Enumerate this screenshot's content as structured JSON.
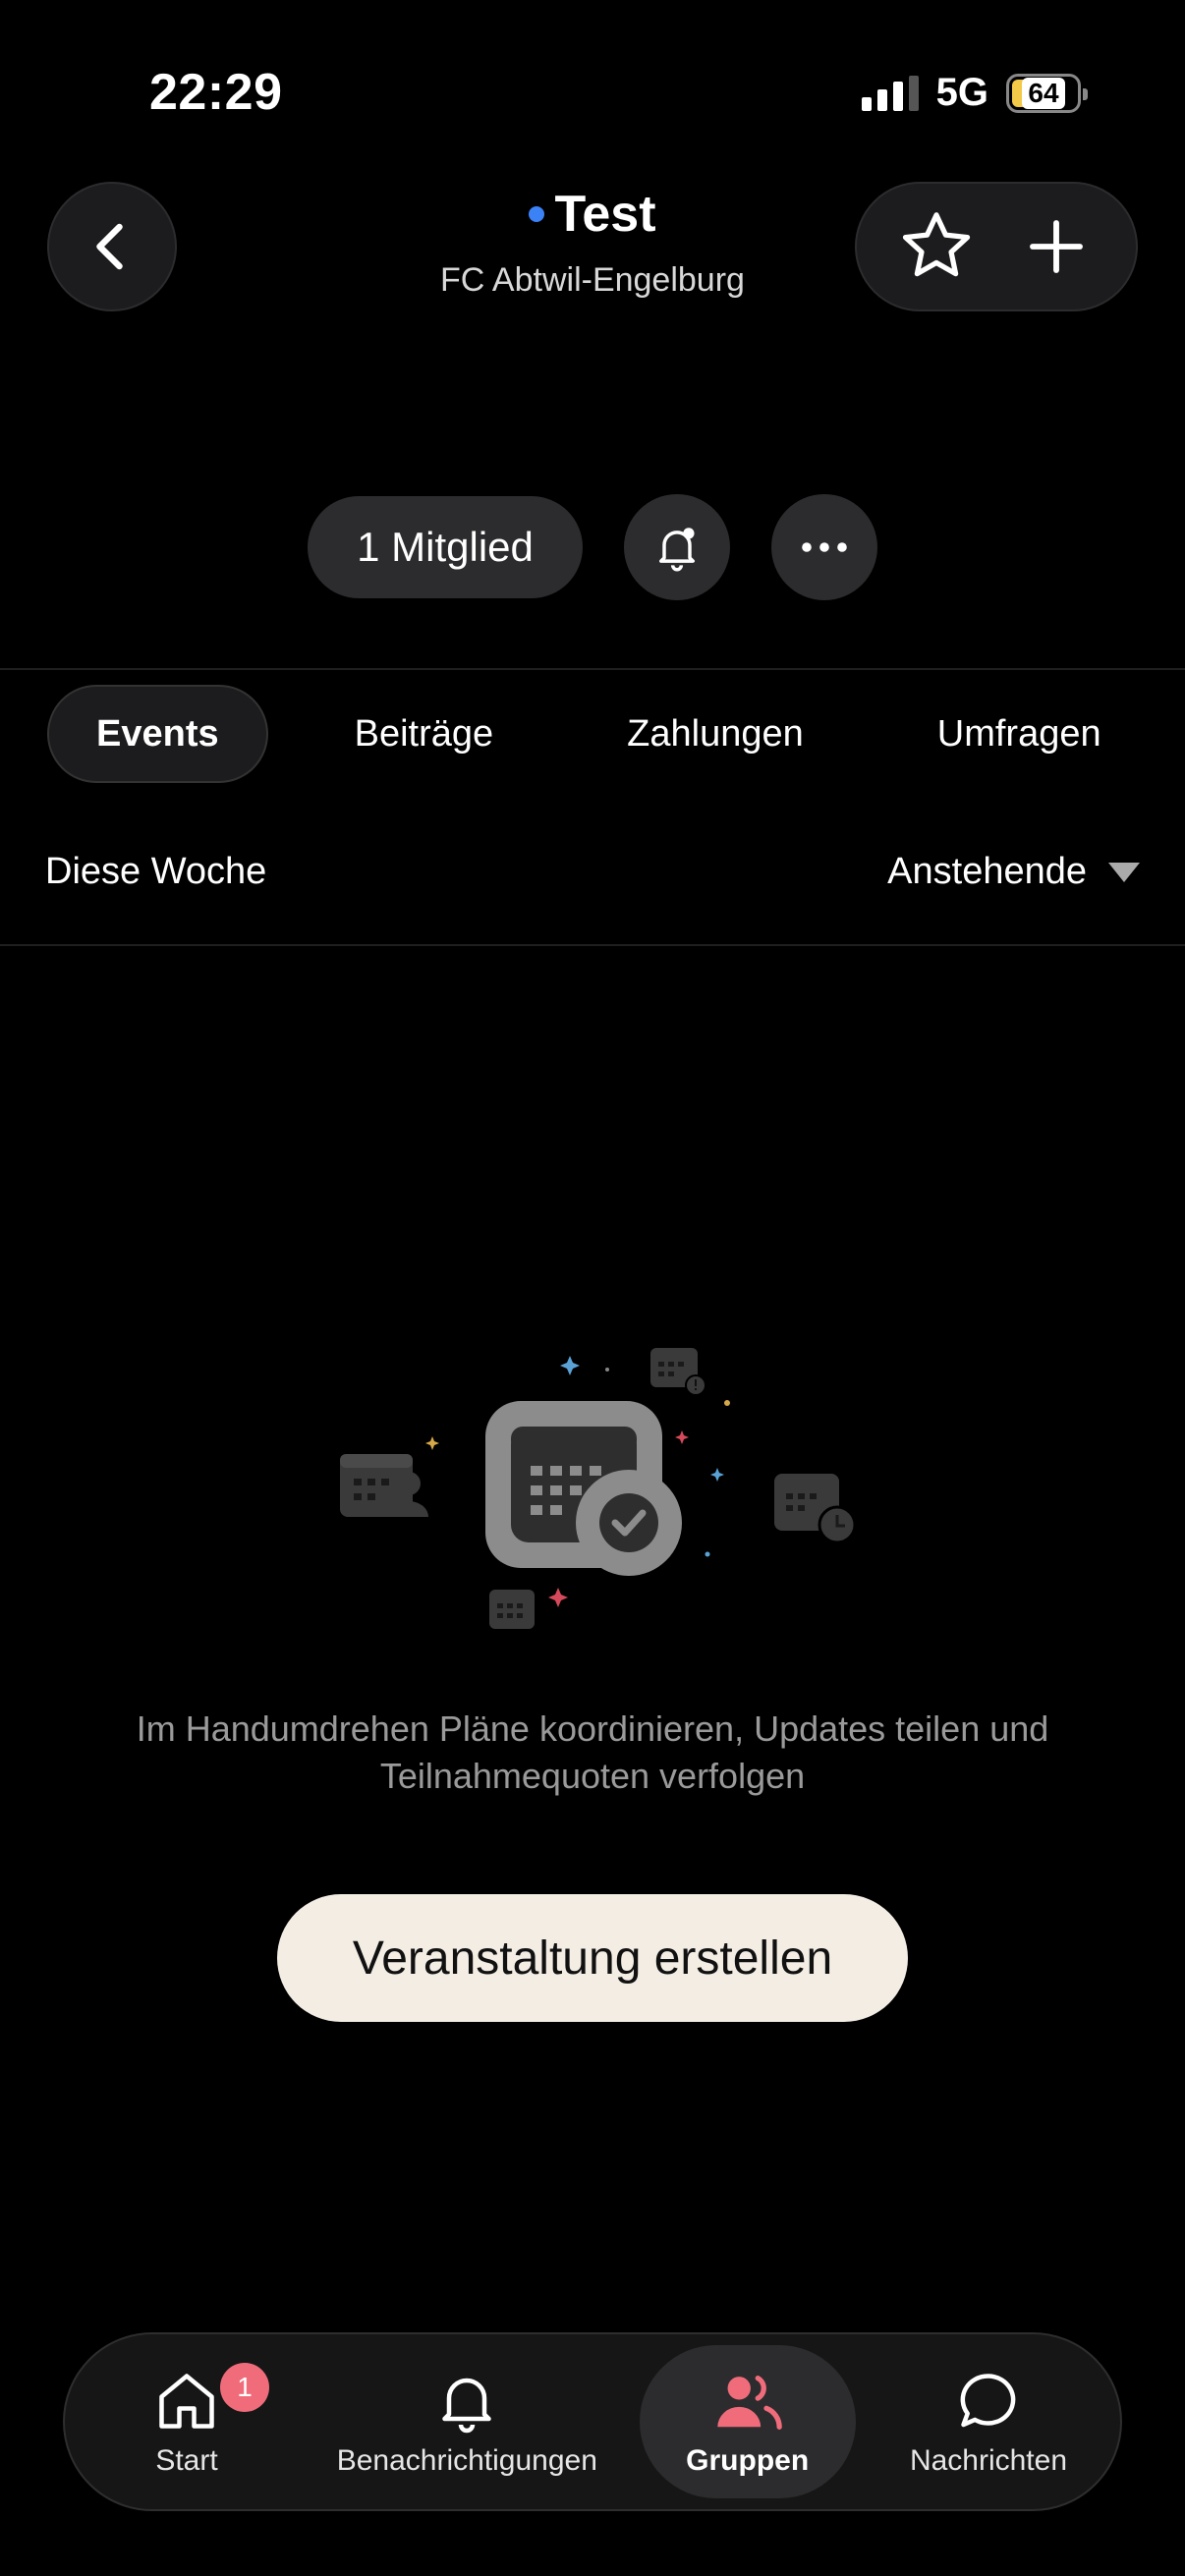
{
  "status_bar": {
    "time": "22:29",
    "network": "5G",
    "battery": "64"
  },
  "header": {
    "title": "Test",
    "subtitle": "FC Abtwil-Engelburg"
  },
  "members": {
    "label": "1 Mitglied"
  },
  "tabs": [
    {
      "label": "Events",
      "active": true
    },
    {
      "label": "Beiträge",
      "active": false
    },
    {
      "label": "Zahlungen",
      "active": false
    },
    {
      "label": "Umfragen",
      "active": false
    }
  ],
  "filter": {
    "left": "Diese Woche",
    "right": "Anstehende"
  },
  "empty_state": {
    "text": "Im Handumdrehen Pläne koordinieren, Updates teilen und Teilnahmequoten verfolgen",
    "cta_label": "Veranstaltung erstellen"
  },
  "bottom_nav": {
    "start": {
      "label": "Start",
      "badge": "1"
    },
    "notifications": {
      "label": "Benachrichtigungen"
    },
    "groups": {
      "label": "Gruppen"
    },
    "messages": {
      "label": "Nachrichten"
    }
  },
  "colors": {
    "accent_dot": "#3b82f6",
    "badge": "#f06c7b",
    "groups_icon": "#f06c7b",
    "cta_bg": "#f3ede4"
  }
}
